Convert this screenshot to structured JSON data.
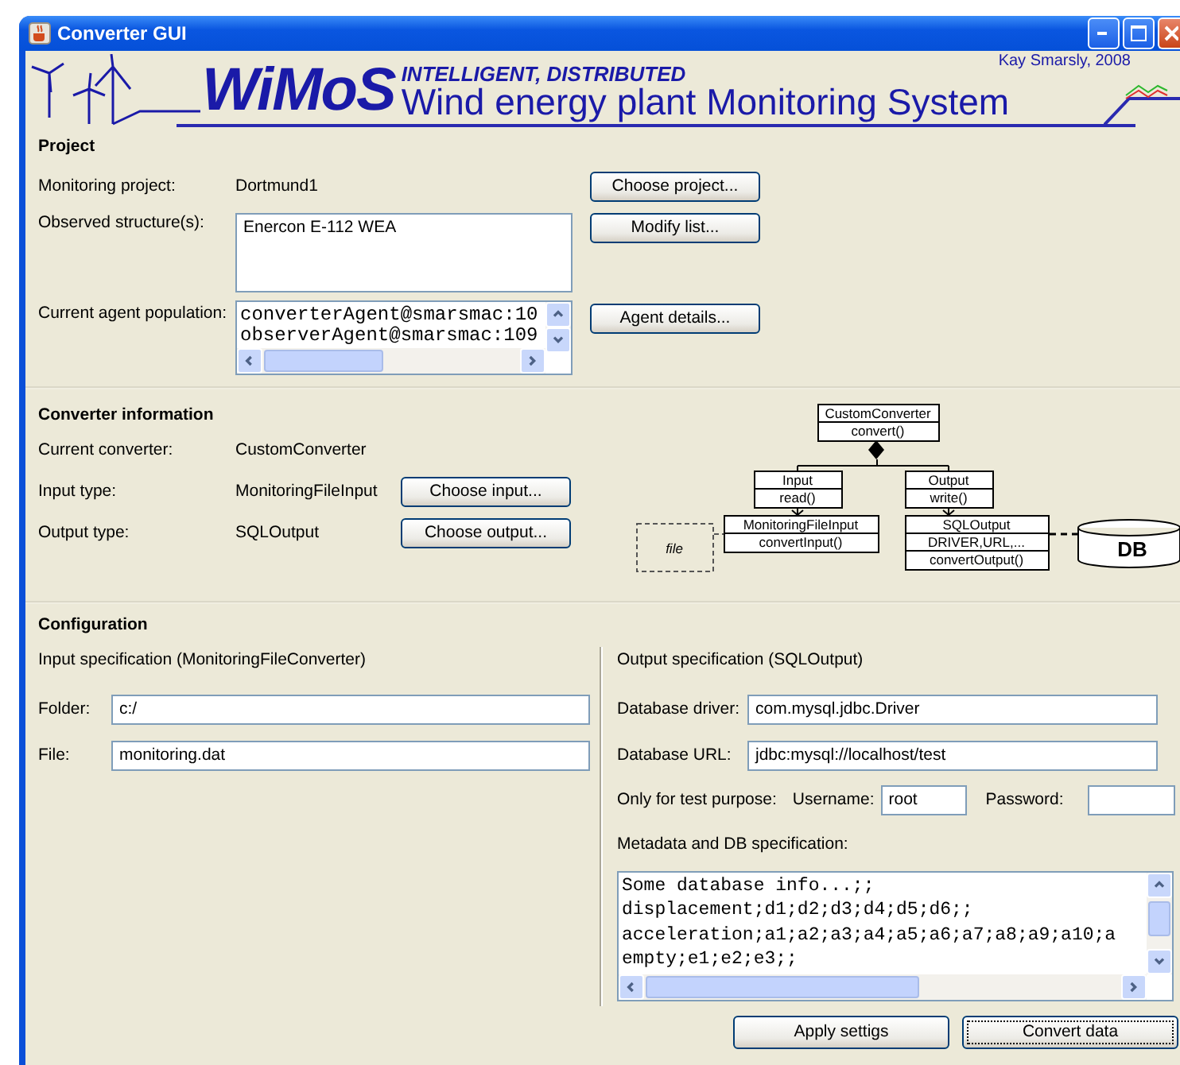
{
  "window": {
    "title": "Converter GUI"
  },
  "banner": {
    "logo": "WiMoS",
    "tagline": "INTELLIGENT, DISTRIBUTED",
    "subtitle": "Wind energy plant Monitoring System",
    "credit": "Kay Smarsly, 2008"
  },
  "project": {
    "heading": "Project",
    "rows": [
      {
        "kind": "value",
        "label": "Monitoring project:",
        "value": "Dortmund1",
        "button": "Choose project..."
      },
      {
        "kind": "list",
        "label": "Observed structure(s):",
        "lines": [
          "Enercon E-112 WEA"
        ],
        "button": "Modify list..."
      },
      {
        "kind": "scroll_list",
        "label": "Current agent population:",
        "lines": [
          "converterAgent@smarsmac:10",
          "observerAgent@smarsmac:109"
        ],
        "button": "Agent details..."
      }
    ]
  },
  "converter": {
    "heading": "Converter information",
    "rows": [
      {
        "label": "Current converter:",
        "value": "CustomConverter"
      },
      {
        "label": "Input type:",
        "value": "MonitoringFileInput",
        "button": "Choose input..."
      },
      {
        "label": "Output type:",
        "value": "SQLOutput",
        "button": "Choose output..."
      }
    ],
    "diagram": {
      "classes": [
        {
          "name": "CustomConverter",
          "members": [
            "convert()"
          ]
        },
        {
          "name": "Input",
          "members": [
            "read()"
          ]
        },
        {
          "name": "Output",
          "members": [
            "write()"
          ]
        },
        {
          "name": "MonitoringFileInput",
          "members": [
            "convertInput()"
          ]
        },
        {
          "name": "SQLOutput",
          "members": [
            "DRIVER,URL,...",
            "convertOutput()"
          ]
        }
      ],
      "file_label": "file",
      "db_label": "DB"
    }
  },
  "configuration": {
    "heading": "Configuration",
    "input": {
      "title": "Input specification (MonitoringFileConverter)",
      "fields": [
        {
          "label": "Folder:",
          "value": "c:/"
        },
        {
          "label": "File:",
          "value": "monitoring.dat"
        }
      ]
    },
    "output": {
      "title": "Output specification (SQLOutput)",
      "fields": [
        {
          "label": "Database driver:",
          "value": "com.mysql.jdbc.Driver"
        },
        {
          "label": "Database URL:",
          "value": "jdbc:mysql://localhost/test"
        }
      ],
      "test": {
        "label": "Only for test purpose:",
        "username_label": "Username:",
        "username": "root",
        "password_label": "Password:"
      },
      "metadata": {
        "label": "Metadata and DB specification:",
        "lines": [
          "Some database info...;;",
          "displacement;d1;d2;d3;d4;d5;d6;;",
          "acceleration;a1;a2;a3;a4;a5;a6;a7;a8;a9;a10;a",
          "empty;e1;e2;e3;;"
        ]
      }
    }
  },
  "buttons": [
    {
      "label": "Apply settigs",
      "focused": false
    },
    {
      "label": "Convert data",
      "focused": true
    }
  ]
}
